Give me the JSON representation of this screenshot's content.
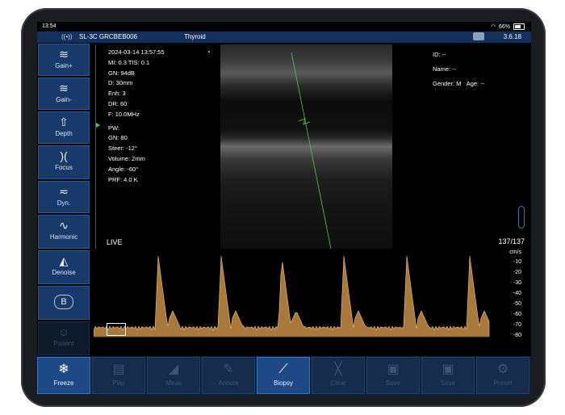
{
  "statusbar": {
    "time": "13:54",
    "battery": "66%"
  },
  "titlebar": {
    "device": "SL-3C GRCBEB006",
    "preset": "Thyroid",
    "version": "3.6.18"
  },
  "sidebar": {
    "items": [
      {
        "label": "Gain+",
        "icon": "gain-plus-icon",
        "glyph": "≋"
      },
      {
        "label": "Gain-",
        "icon": "gain-minus-icon",
        "glyph": "≋"
      },
      {
        "label": "Depth",
        "icon": "depth-icon",
        "glyph": "⇧"
      },
      {
        "label": "Focus",
        "icon": "focus-icon",
        "glyph": ")("
      },
      {
        "label": "Dyn.",
        "icon": "dynamic-range-icon",
        "glyph": "≂"
      },
      {
        "label": "Harmonic",
        "icon": "harmonic-icon",
        "glyph": "∿"
      },
      {
        "label": "Denoise",
        "icon": "denoise-icon",
        "glyph": "◭"
      },
      {
        "label": "",
        "icon": "b-mode-icon",
        "glyph": "B"
      },
      {
        "label": "Patient",
        "icon": "patient-icon",
        "glyph": "☺"
      }
    ]
  },
  "image_info": {
    "datetime": "2024-03-14 13:57:55",
    "mi_tis": "MI: 0.3  TIS: 0.1",
    "gn": "GN: 94dB",
    "d": "D: 30mm",
    "enh": "Enh: 3",
    "dr": "DR: 60",
    "f": "F: 10.0MHz",
    "pw": "PW:",
    "pw_gn": "GN: 80",
    "steer": "Steer: -12°",
    "volume": "Volume: 2mm",
    "angle": "Angle: -60°",
    "prf": "PRF: 4.0 K"
  },
  "patient_info": {
    "id": "ID: --",
    "name": "Name: --",
    "gender": "Gender: M",
    "age": "Age: --"
  },
  "live_label": "LIVE",
  "frame_counter": "137/137",
  "doppler": {
    "unit": "cm/s",
    "scale": [
      "-10",
      "-20",
      "-30",
      "-40",
      "-50",
      "-60",
      "-70",
      "-80"
    ]
  },
  "bottombar": {
    "buttons": [
      {
        "label": "Freeze",
        "icon": "snowflake-icon",
        "glyph": "❄",
        "active": true
      },
      {
        "label": "Play",
        "icon": "film-icon",
        "glyph": "▤",
        "active": false
      },
      {
        "label": "Meas",
        "icon": "measure-icon",
        "glyph": "◢",
        "active": false
      },
      {
        "label": "Annote",
        "icon": "annotate-icon",
        "glyph": "✎",
        "active": false
      },
      {
        "label": "Biopsy",
        "icon": "biopsy-icon",
        "glyph": "⟋",
        "active": true
      },
      {
        "label": "Clear",
        "icon": "clear-icon",
        "glyph": "╳",
        "active": false
      },
      {
        "label": "Save",
        "icon": "save-image-icon",
        "glyph": "▣",
        "active": false
      },
      {
        "label": "Save",
        "icon": "save-video-icon",
        "glyph": "▣",
        "active": false
      },
      {
        "label": "Preset",
        "icon": "gear-icon",
        "glyph": "⚙",
        "active": false
      }
    ]
  },
  "colors": {
    "accent": "#1d4a86",
    "title": "#12315c",
    "doppler": "#e0a050",
    "needle": "#3ed04a"
  }
}
